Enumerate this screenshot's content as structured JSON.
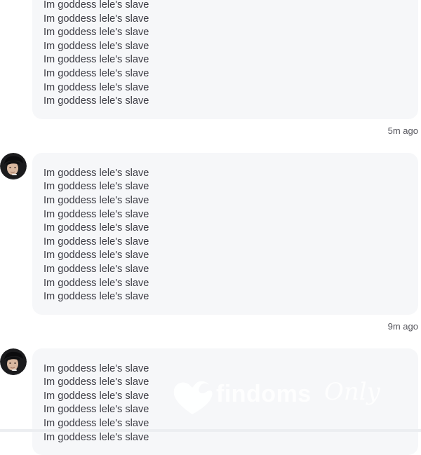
{
  "messages": [
    {
      "lines": [
        "Im goddess lele's slave",
        "Im goddess lele's slave",
        "Im goddess lele's slave",
        "Im goddess lele's slave",
        "Im goddess lele's slave",
        "Im goddess lele's slave",
        "Im goddess lele's slave",
        "Im goddess lele's slave"
      ],
      "time": "5m ago"
    },
    {
      "lines": [
        "Im goddess lele's slave",
        "Im goddess lele's slave",
        "Im goddess lele's slave",
        "Im goddess lele's slave",
        "Im goddess lele's slave",
        "Im goddess lele's slave",
        "Im goddess lele's slave",
        "Im goddess lele's slave",
        "Im goddess lele's slave",
        "Im goddess lele's slave"
      ],
      "time": "9m ago"
    },
    {
      "lines": [
        "Im goddess lele's slave",
        "Im goddess lele's slave",
        "Im goddess lele's slave",
        "Im goddess lele's slave",
        "Im goddess lele's slave",
        "Im goddess lele's slave"
      ]
    }
  ],
  "watermark": {
    "brand": "findoms",
    "script": "Only",
    "icon": "heart-icon"
  },
  "colors": {
    "bubble": "#f6f7f9",
    "text": "#3d3d45",
    "time": "#55555c"
  }
}
